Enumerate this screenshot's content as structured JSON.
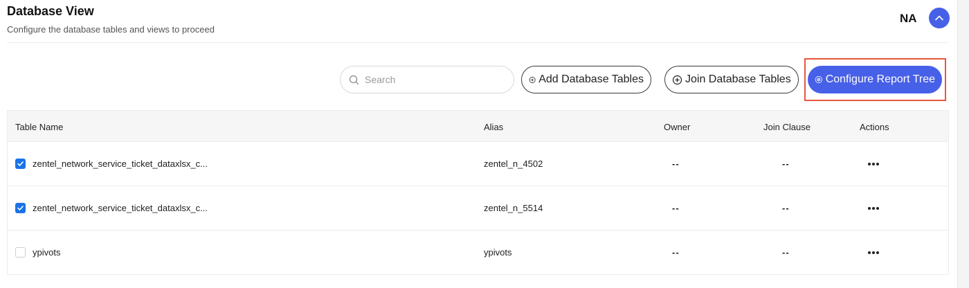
{
  "header": {
    "title": "Database View",
    "subtitle": "Configure the database tables and views to proceed",
    "user_initials": "NA"
  },
  "toolbar": {
    "search_placeholder": "Search",
    "add_label": "Add Database Tables",
    "join_label": "Join Database Tables",
    "configure_label": "Configure Report Tree"
  },
  "table": {
    "columns": [
      "Table Name",
      "Alias",
      "Owner",
      "Join Clause",
      "Actions"
    ],
    "rows": [
      {
        "checked": true,
        "name": "zentel_network_service_ticket_dataxlsx_c...",
        "alias": "zentel_n_4502",
        "owner": "--",
        "join_clause": "--"
      },
      {
        "checked": true,
        "name": "zentel_network_service_ticket_dataxlsx_c...",
        "alias": "zentel_n_5514",
        "owner": "--",
        "join_clause": "--"
      },
      {
        "checked": false,
        "name": "ypivots",
        "alias": "ypivots",
        "owner": "--",
        "join_clause": "--"
      }
    ]
  },
  "colors": {
    "primary": "#4760e8",
    "checkbox": "#1a73e8",
    "highlight": "#e8553e"
  },
  "icons": {
    "collapse": "chevron-up-icon",
    "search": "search-icon",
    "add": "plus-circle-icon",
    "configure": "settings-circle-icon",
    "actions": "more-horizontal-icon"
  }
}
